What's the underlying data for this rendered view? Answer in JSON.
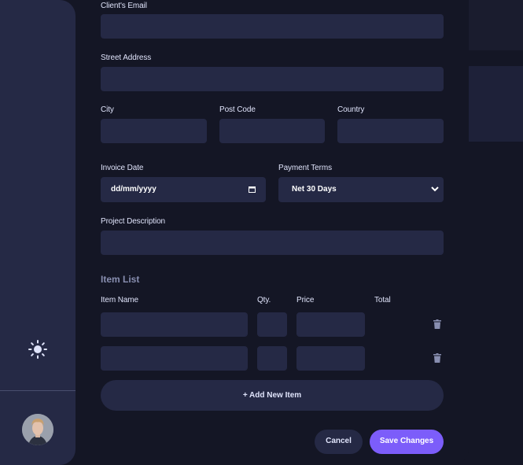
{
  "form": {
    "clients_email_label": "Client's Email",
    "street_address_label": "Street Address",
    "city_label": "City",
    "post_code_label": "Post Code",
    "country_label": "Country",
    "invoice_date_label": "Invoice Date",
    "invoice_date_value": "dd/mm/yyyy",
    "payment_terms_label": "Payment Terms",
    "payment_terms_value": "Net 30 Days",
    "project_description_label": "Project Description"
  },
  "item_list": {
    "title": "Item List",
    "headers": [
      "Item Name",
      "Qty.",
      "Price",
      "Total"
    ],
    "add_button": "+ Add New Item"
  },
  "actions": {
    "cancel": "Cancel",
    "save": "Save Changes"
  },
  "colors": {
    "accent": "#7c5dfa",
    "background": "#141625",
    "field_bg": "#252945"
  }
}
